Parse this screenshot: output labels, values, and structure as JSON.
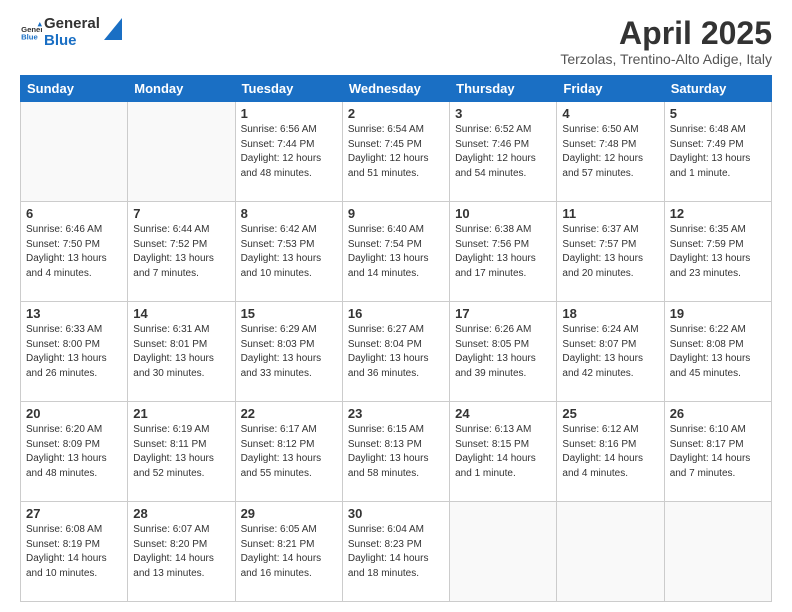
{
  "logo": {
    "line1": "General",
    "line2": "Blue"
  },
  "title": "April 2025",
  "subtitle": "Terzolas, Trentino-Alto Adige, Italy",
  "days_of_week": [
    "Sunday",
    "Monday",
    "Tuesday",
    "Wednesday",
    "Thursday",
    "Friday",
    "Saturday"
  ],
  "weeks": [
    [
      {
        "day": null
      },
      {
        "day": null
      },
      {
        "day": "1",
        "sunrise": "6:56 AM",
        "sunset": "7:44 PM",
        "daylight": "12 hours and 48 minutes."
      },
      {
        "day": "2",
        "sunrise": "6:54 AM",
        "sunset": "7:45 PM",
        "daylight": "12 hours and 51 minutes."
      },
      {
        "day": "3",
        "sunrise": "6:52 AM",
        "sunset": "7:46 PM",
        "daylight": "12 hours and 54 minutes."
      },
      {
        "day": "4",
        "sunrise": "6:50 AM",
        "sunset": "7:48 PM",
        "daylight": "12 hours and 57 minutes."
      },
      {
        "day": "5",
        "sunrise": "6:48 AM",
        "sunset": "7:49 PM",
        "daylight": "13 hours and 1 minute."
      }
    ],
    [
      {
        "day": "6",
        "sunrise": "6:46 AM",
        "sunset": "7:50 PM",
        "daylight": "13 hours and 4 minutes."
      },
      {
        "day": "7",
        "sunrise": "6:44 AM",
        "sunset": "7:52 PM",
        "daylight": "13 hours and 7 minutes."
      },
      {
        "day": "8",
        "sunrise": "6:42 AM",
        "sunset": "7:53 PM",
        "daylight": "13 hours and 10 minutes."
      },
      {
        "day": "9",
        "sunrise": "6:40 AM",
        "sunset": "7:54 PM",
        "daylight": "13 hours and 14 minutes."
      },
      {
        "day": "10",
        "sunrise": "6:38 AM",
        "sunset": "7:56 PM",
        "daylight": "13 hours and 17 minutes."
      },
      {
        "day": "11",
        "sunrise": "6:37 AM",
        "sunset": "7:57 PM",
        "daylight": "13 hours and 20 minutes."
      },
      {
        "day": "12",
        "sunrise": "6:35 AM",
        "sunset": "7:59 PM",
        "daylight": "13 hours and 23 minutes."
      }
    ],
    [
      {
        "day": "13",
        "sunrise": "6:33 AM",
        "sunset": "8:00 PM",
        "daylight": "13 hours and 26 minutes."
      },
      {
        "day": "14",
        "sunrise": "6:31 AM",
        "sunset": "8:01 PM",
        "daylight": "13 hours and 30 minutes."
      },
      {
        "day": "15",
        "sunrise": "6:29 AM",
        "sunset": "8:03 PM",
        "daylight": "13 hours and 33 minutes."
      },
      {
        "day": "16",
        "sunrise": "6:27 AM",
        "sunset": "8:04 PM",
        "daylight": "13 hours and 36 minutes."
      },
      {
        "day": "17",
        "sunrise": "6:26 AM",
        "sunset": "8:05 PM",
        "daylight": "13 hours and 39 minutes."
      },
      {
        "day": "18",
        "sunrise": "6:24 AM",
        "sunset": "8:07 PM",
        "daylight": "13 hours and 42 minutes."
      },
      {
        "day": "19",
        "sunrise": "6:22 AM",
        "sunset": "8:08 PM",
        "daylight": "13 hours and 45 minutes."
      }
    ],
    [
      {
        "day": "20",
        "sunrise": "6:20 AM",
        "sunset": "8:09 PM",
        "daylight": "13 hours and 48 minutes."
      },
      {
        "day": "21",
        "sunrise": "6:19 AM",
        "sunset": "8:11 PM",
        "daylight": "13 hours and 52 minutes."
      },
      {
        "day": "22",
        "sunrise": "6:17 AM",
        "sunset": "8:12 PM",
        "daylight": "13 hours and 55 minutes."
      },
      {
        "day": "23",
        "sunrise": "6:15 AM",
        "sunset": "8:13 PM",
        "daylight": "13 hours and 58 minutes."
      },
      {
        "day": "24",
        "sunrise": "6:13 AM",
        "sunset": "8:15 PM",
        "daylight": "14 hours and 1 minute."
      },
      {
        "day": "25",
        "sunrise": "6:12 AM",
        "sunset": "8:16 PM",
        "daylight": "14 hours and 4 minutes."
      },
      {
        "day": "26",
        "sunrise": "6:10 AM",
        "sunset": "8:17 PM",
        "daylight": "14 hours and 7 minutes."
      }
    ],
    [
      {
        "day": "27",
        "sunrise": "6:08 AM",
        "sunset": "8:19 PM",
        "daylight": "14 hours and 10 minutes."
      },
      {
        "day": "28",
        "sunrise": "6:07 AM",
        "sunset": "8:20 PM",
        "daylight": "14 hours and 13 minutes."
      },
      {
        "day": "29",
        "sunrise": "6:05 AM",
        "sunset": "8:21 PM",
        "daylight": "14 hours and 16 minutes."
      },
      {
        "day": "30",
        "sunrise": "6:04 AM",
        "sunset": "8:23 PM",
        "daylight": "14 hours and 18 minutes."
      },
      {
        "day": null
      },
      {
        "day": null
      },
      {
        "day": null
      }
    ]
  ]
}
